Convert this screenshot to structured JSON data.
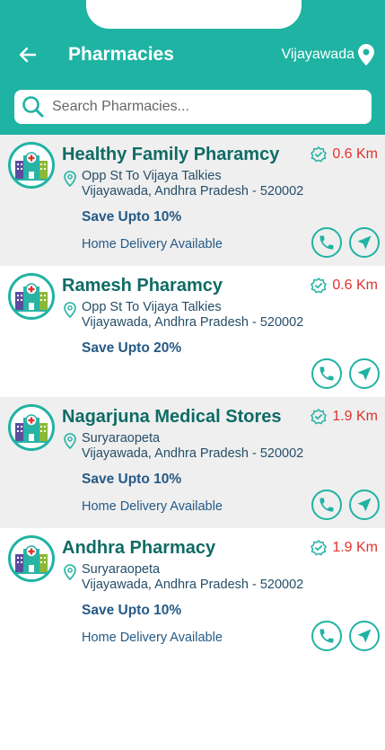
{
  "header": {
    "title": "Pharmacies",
    "location": "Vijayawada"
  },
  "search": {
    "placeholder": "Search Pharmacies..."
  },
  "colors": {
    "primary": "#1fb3a3",
    "name": "#0f6b65",
    "distance": "#e0322d",
    "text": "#255a86"
  },
  "pharmacies": [
    {
      "name": "Healthy Family Pharamcy",
      "distance": "0.6 Km",
      "address_line1": "Opp St To Vijaya Talkies",
      "address_line2": "Vijayawada, Andhra Pradesh - 520002",
      "save": "Save Upto 10%",
      "delivery": "Home Delivery Available"
    },
    {
      "name": "Ramesh Pharamcy",
      "distance": "0.6 Km",
      "address_line1": "Opp St To Vijaya Talkies",
      "address_line2": "Vijayawada, Andhra Pradesh - 520002",
      "save": "Save Upto 20%",
      "delivery": ""
    },
    {
      "name": "Nagarjuna Medical Stores",
      "distance": "1.9 Km",
      "address_line1": "Suryaraopeta",
      "address_line2": "Vijayawada, Andhra Pradesh - 520002",
      "save": "Save Upto 10%",
      "delivery": "Home Delivery Available"
    },
    {
      "name": "Andhra Pharmacy",
      "distance": "1.9 Km",
      "address_line1": "Suryaraopeta",
      "address_line2": "Vijayawada, Andhra Pradesh - 520002",
      "save": "Save Upto 10%",
      "delivery": "Home Delivery Available"
    }
  ]
}
